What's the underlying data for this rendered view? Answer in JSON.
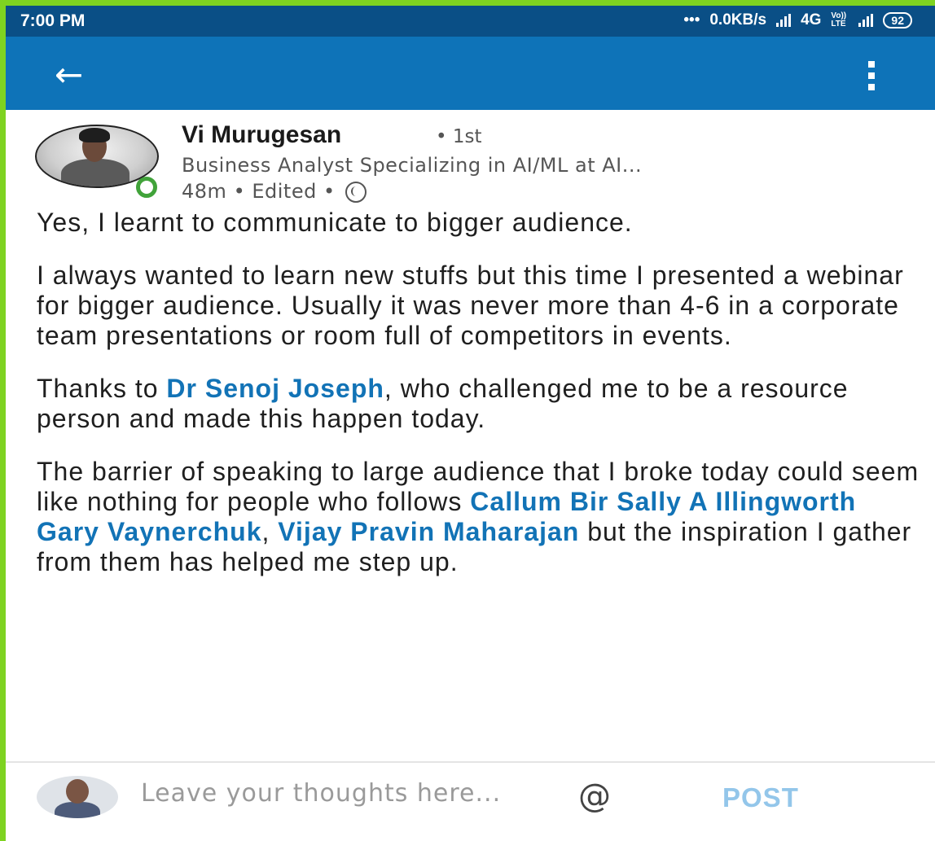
{
  "status_bar": {
    "time": "7:00 PM",
    "dots": "•••",
    "network_speed": "0.0KB/s",
    "network_type": "4G",
    "volte": "Vo)) LTE",
    "battery": "92"
  },
  "app_bar": {
    "back_icon": "arrow-left",
    "menu_icon": "kebab-menu"
  },
  "post": {
    "author_name": "Vi Murugesan",
    "connection_degree": "• 1st",
    "headline": "Business Analyst Specializing in AI/ML at AI...",
    "time_ago": "48m",
    "edited": "• Edited •",
    "visibility_icon": "globe",
    "paragraphs": [
      {
        "text": "Yes, I learnt to communicate to bigger audience."
      },
      {
        "text": "I always wanted to learn new stuffs but this time I presented a webinar for bigger audience. Usually it was never more than 4-6 in a corporate team presentations or room full of competitors in events."
      },
      {
        "t1": "Thanks to ",
        "mention1": "Dr Senoj Joseph",
        "t2": ", who challenged me to be a resource person and made this happen today."
      },
      {
        "t1": "The barrier of speaking to large audience that I broke today could seem like nothing for people who follows ",
        "mention1": "Callum Bir Sally A Illingworth Gary Vaynerchuk",
        "t2": ", ",
        "mention2": "Vijay Pravin Maharajan",
        "t3": " but the inspiration I gather from them has helped me step up."
      }
    ]
  },
  "composer": {
    "placeholder": "Leave your thoughts here...",
    "mention_icon": "at-sign",
    "post_label": "POST"
  },
  "colors": {
    "border": "#7ed321",
    "status_bar": "#0a4f86",
    "app_bar": "#0e73b8",
    "mention": "#1273b6",
    "post_disabled": "#93c6ea"
  }
}
